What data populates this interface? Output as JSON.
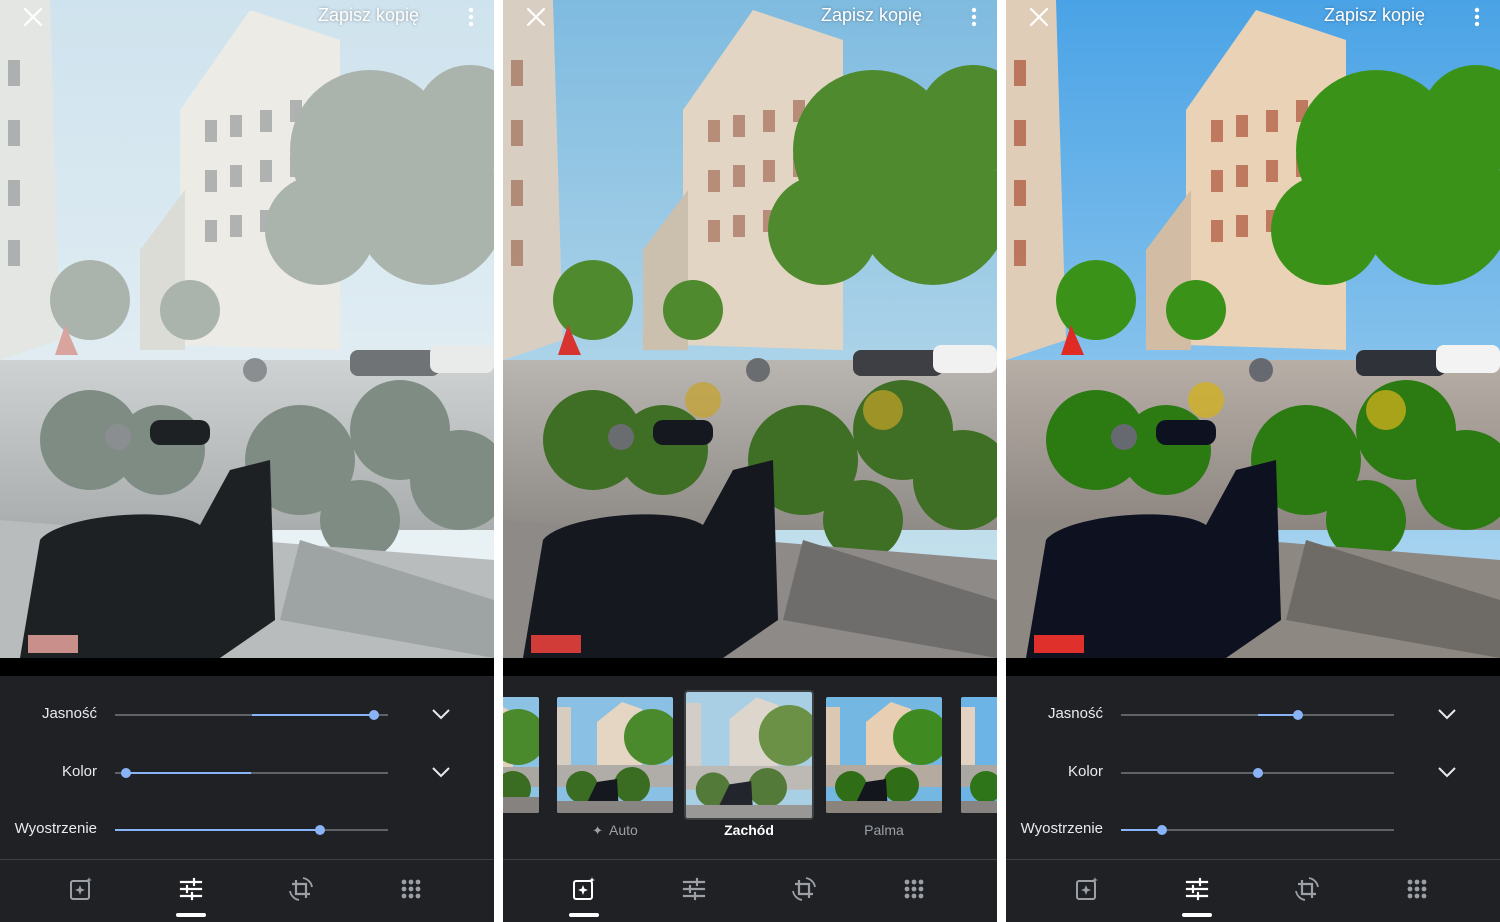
{
  "colors": {
    "panel_bg": "#202124",
    "slider_active": "#8ab4f8",
    "slider_track": "#5f6368",
    "text_primary": "#e8eaed",
    "text_secondary": "#9aa0a6",
    "icon_active": "#ffffff",
    "icon_inactive": "#9aa0a6"
  },
  "screens": [
    {
      "mode": "adjust",
      "header": {
        "close_icon": "close-icon",
        "save_label": "Zapisz kopię",
        "more_icon": "more-vert-icon"
      },
      "sliders": [
        {
          "label": "Jasność",
          "value": 0.95,
          "center": 0.5,
          "expand_icon": "chevron-down-icon"
        },
        {
          "label": "Kolor",
          "value": 0.04,
          "center": 0.5,
          "expand_icon": "chevron-down-icon"
        },
        {
          "label": "Wyostrzenie",
          "value": 0.75,
          "center": 0.0
        }
      ],
      "nav": {
        "active": 1,
        "items": [
          "suggestions-icon",
          "adjust-sliders-icon",
          "crop-rotate-icon",
          "more-tools-icon"
        ]
      }
    },
    {
      "mode": "filters",
      "header": {
        "close_icon": "close-icon",
        "save_label": "Zapisz kopię",
        "more_icon": "more-vert-icon"
      },
      "filters": [
        {
          "label": "Auto",
          "icon": "sparkle-icon",
          "selected": false
        },
        {
          "label": "Zachód",
          "selected": true
        },
        {
          "label": "Palma",
          "selected": false
        }
      ],
      "nav": {
        "active": 0,
        "items": [
          "suggestions-icon",
          "adjust-sliders-icon",
          "crop-rotate-icon",
          "more-tools-icon"
        ]
      }
    },
    {
      "mode": "adjust",
      "header": {
        "close_icon": "close-icon",
        "save_label": "Zapisz kopię",
        "more_icon": "more-vert-icon"
      },
      "sliders": [
        {
          "label": "Jasność",
          "value": 0.65,
          "center": 0.5,
          "expand_icon": "chevron-down-icon"
        },
        {
          "label": "Kolor",
          "value": 0.5,
          "center": 0.5,
          "expand_icon": "chevron-down-icon"
        },
        {
          "label": "Wyostrzenie",
          "value": 0.15,
          "center": 0.0
        }
      ],
      "nav": {
        "active": 1,
        "items": [
          "suggestions-icon",
          "adjust-sliders-icon",
          "crop-rotate-icon",
          "more-tools-icon"
        ]
      }
    }
  ]
}
